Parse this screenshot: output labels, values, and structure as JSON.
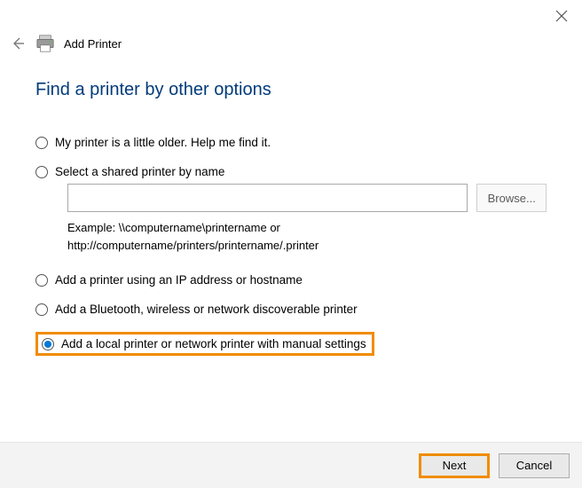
{
  "header": {
    "window_title": "Add Printer"
  },
  "page_title": "Find a printer by other options",
  "options": {
    "older": {
      "label": "My printer is a little older. Help me find it.",
      "selected": false
    },
    "shared": {
      "label": "Select a shared printer by name",
      "selected": false
    },
    "ip": {
      "label": "Add a printer using an IP address or hostname",
      "selected": false
    },
    "bluetooth": {
      "label": "Add a Bluetooth, wireless or network discoverable printer",
      "selected": false
    },
    "manual": {
      "label": "Add a local printer or network printer with manual settings",
      "selected": true
    }
  },
  "shared_block": {
    "input_value": "",
    "input_placeholder": "",
    "browse_label": "Browse...",
    "example_line1": "Example: \\\\computername\\printername or",
    "example_line2": "http://computername/printers/printername/.printer"
  },
  "footer": {
    "next_label": "Next",
    "cancel_label": "Cancel"
  }
}
